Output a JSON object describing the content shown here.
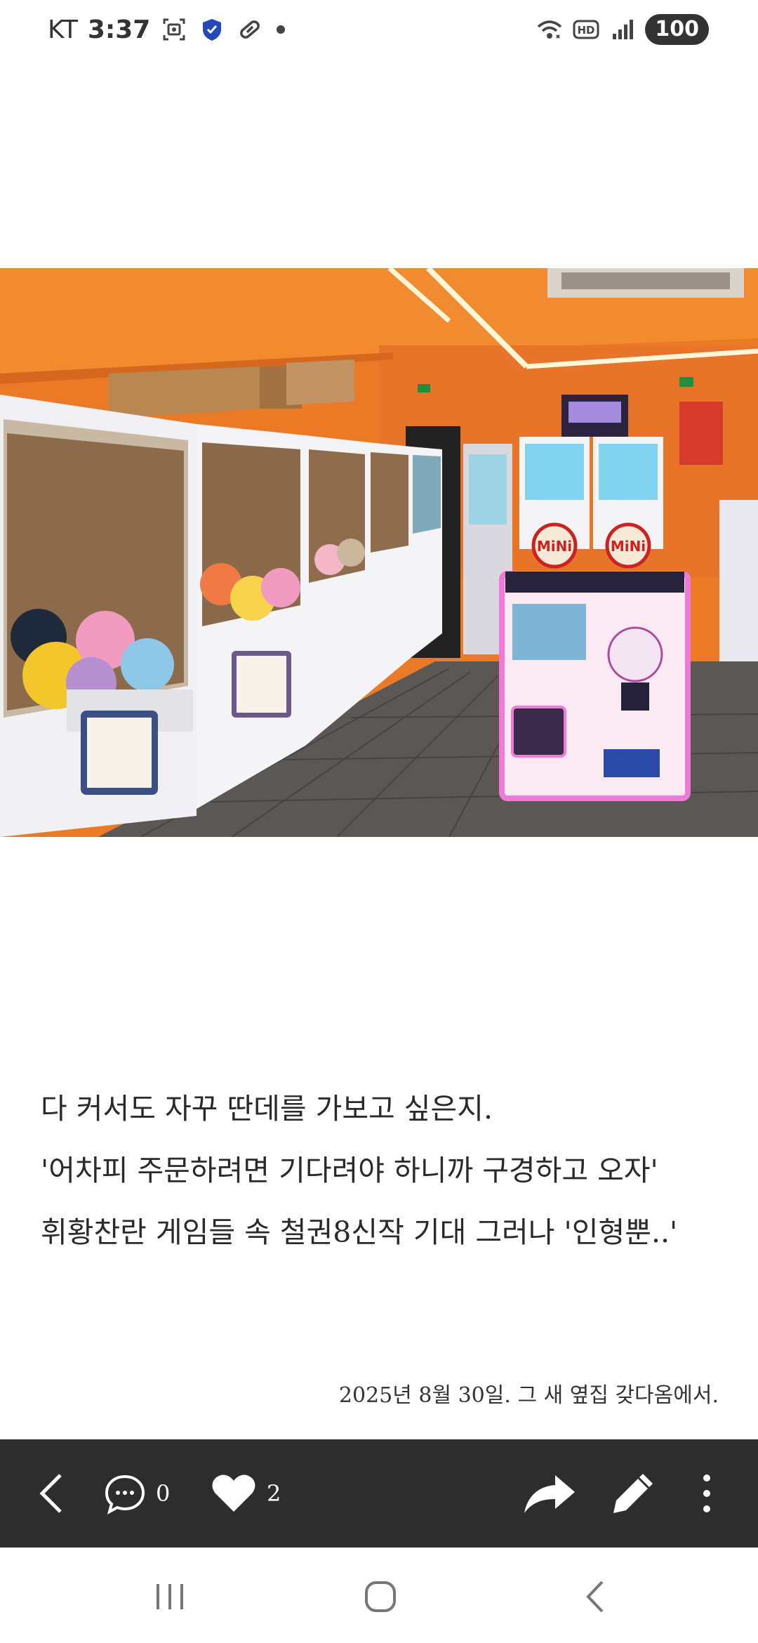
{
  "status_bar": {
    "carrier": "KT",
    "time": "3:37",
    "battery": "100",
    "icons": [
      "screenshot-icon",
      "shield-icon",
      "pill-icon",
      "notification-dot",
      "wifi-icon",
      "hd-icon",
      "signal-icon"
    ]
  },
  "photo": {
    "alt": "",
    "machine_labels": [
      "MiNi",
      "MiNi"
    ]
  },
  "caption": {
    "lines": [
      "다 커서도 자꾸 딴데를 가보고 싶은지.",
      "'어차피 주문하려면 기다려야 하니까 구경하고 오자'",
      "휘황찬란 게임들 속 철권8신작 기대 그러나 '인형뿐..'"
    ],
    "date_note": "2025년 8월 30일. 그 새 옆집 갖다옴에서."
  },
  "action_bar": {
    "comment_count": "0",
    "like_count": "2",
    "icons": [
      "back-icon",
      "comment-icon",
      "heart-icon",
      "share-icon",
      "edit-icon",
      "more-icon"
    ]
  },
  "nav_bar": {
    "icons": [
      "recents-icon",
      "home-icon",
      "back-nav-icon"
    ]
  },
  "colors": {
    "action_bar_bg": "#2d2d2d",
    "wall_orange": "#f07a1e"
  }
}
